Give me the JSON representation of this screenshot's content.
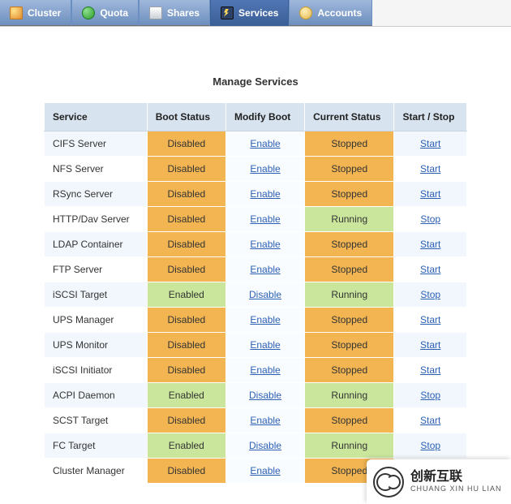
{
  "nav": {
    "tabs": [
      {
        "label": "Cluster",
        "icon": "cluster-icon"
      },
      {
        "label": "Quota",
        "icon": "quota-icon"
      },
      {
        "label": "Shares",
        "icon": "shares-icon"
      },
      {
        "label": "Services",
        "icon": "services-icon",
        "active": true
      },
      {
        "label": "Accounts",
        "icon": "accounts-icon"
      }
    ]
  },
  "page": {
    "title": "Manage Services"
  },
  "columns": {
    "service": "Service",
    "boot": "Boot Status",
    "modify": "Modify Boot",
    "current": "Current Status",
    "startstop": "Start / Stop"
  },
  "labels": {
    "enable": "Enable",
    "disable": "Disable",
    "start": "Start",
    "stop": "Stop"
  },
  "services": [
    {
      "name": "CIFS Server",
      "boot": "Disabled",
      "current": "Stopped"
    },
    {
      "name": "NFS Server",
      "boot": "Disabled",
      "current": "Stopped"
    },
    {
      "name": "RSync Server",
      "boot": "Disabled",
      "current": "Stopped"
    },
    {
      "name": "HTTP/Dav Server",
      "boot": "Disabled",
      "current": "Running"
    },
    {
      "name": "LDAP Container",
      "boot": "Disabled",
      "current": "Stopped"
    },
    {
      "name": "FTP Server",
      "boot": "Disabled",
      "current": "Stopped"
    },
    {
      "name": "iSCSI Target",
      "boot": "Enabled",
      "current": "Running"
    },
    {
      "name": "UPS Manager",
      "boot": "Disabled",
      "current": "Stopped"
    },
    {
      "name": "UPS Monitor",
      "boot": "Disabled",
      "current": "Stopped"
    },
    {
      "name": "iSCSI Initiator",
      "boot": "Disabled",
      "current": "Stopped"
    },
    {
      "name": "ACPI Daemon",
      "boot": "Enabled",
      "current": "Running"
    },
    {
      "name": "SCST Target",
      "boot": "Disabled",
      "current": "Stopped"
    },
    {
      "name": "FC Target",
      "boot": "Enabled",
      "current": "Running"
    },
    {
      "name": "Cluster Manager",
      "boot": "Disabled",
      "current": "Stopped"
    }
  ],
  "brand": {
    "name": "创新互联",
    "sub": "CHUANG XIN HU LIAN"
  },
  "colors": {
    "toolbar_hi": "#9fb7db",
    "toolbar_lo": "#6d8fbe",
    "active_hi": "#5076b4",
    "active_lo": "#3b5f97",
    "header_bg": "#d7e3ef",
    "warn_bg": "#f2b552",
    "ok_bg": "#c9e69c",
    "link": "#2b5fb4"
  }
}
